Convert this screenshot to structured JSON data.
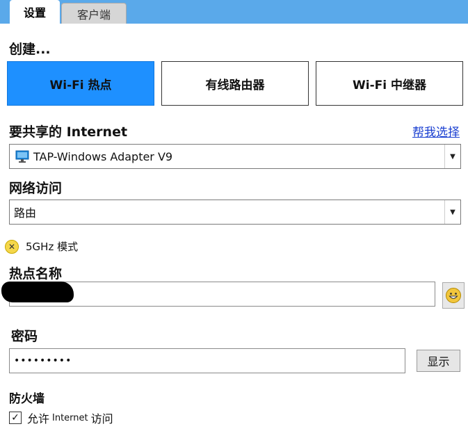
{
  "tabs": [
    {
      "label": "设置",
      "active": true
    },
    {
      "label": "客户端",
      "active": false
    }
  ],
  "create": {
    "label": "创建...",
    "modes": [
      {
        "label": "Wi-Fi 热点",
        "selected": true
      },
      {
        "label": "有线路由器",
        "selected": false
      },
      {
        "label": "Wi-Fi 中继器",
        "selected": false
      }
    ]
  },
  "share": {
    "label": "要共享的 Internet",
    "help_link": "帮我选择",
    "adapter": "TAP-Windows Adapter V9",
    "adapter_icon": "monitor-icon"
  },
  "network_access": {
    "label": "网络访问",
    "value": "路由"
  },
  "fivegh": {
    "label": "5GHz 模式",
    "status_icon": "x-circle-icon"
  },
  "hotspot_name": {
    "label": "热点名称",
    "value": ""
  },
  "password": {
    "label": "密码",
    "value": "•••••••••",
    "show_button": "显示"
  },
  "firewall": {
    "label": "防火墙",
    "allow_prefix": "允许",
    "allow_mid": "Internet",
    "allow_suffix": "访问",
    "allow_checked": true
  },
  "colors": {
    "tabbar": "#5aa9ea",
    "selected_mode": "#1e90ff",
    "link": "#1a3fd1"
  }
}
